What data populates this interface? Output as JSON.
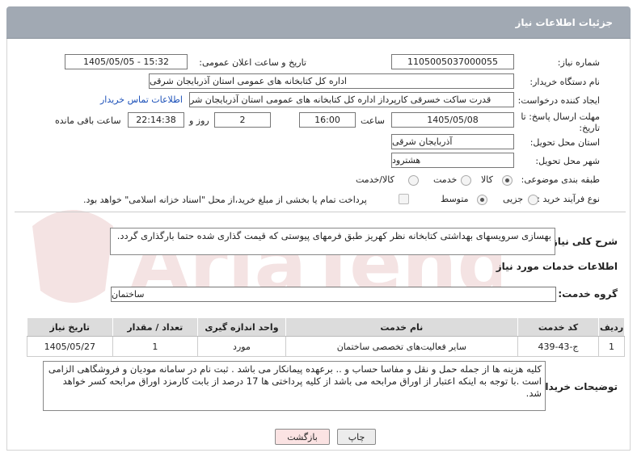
{
  "header": {
    "title": "جزئیات اطلاعات نیاز"
  },
  "fields": {
    "need_number_label": "شماره نیاز:",
    "need_number": "1105005037000055",
    "announce_label": "تاریخ و ساعت اعلان عمومی:",
    "announce_value": "1405/05/05 - 15:32",
    "buyer_org_label": "نام دستگاه خریدار:",
    "buyer_org": "اداره کل کتابخانه های عمومی استان آذربایجان شرقی",
    "creator_label": "ایجاد کننده درخواست:",
    "creator": "قدرت ساکت خسرقی کارپرداز اداره کل کتابخانه های عمومی استان آذربایجان شر",
    "contact_link": "اطلاعات تماس خریدار",
    "deadline_label_1": "مهلت ارسال پاسخ: تا",
    "deadline_label_2": "تاریخ:",
    "deadline_date": "1405/05/08",
    "time_label": "ساعت",
    "deadline_time": "16:00",
    "days_value": "2",
    "days_label": "روز و",
    "remaining_time": "22:14:38",
    "remaining_label": "ساعت باقی مانده",
    "province_label": "استان محل تحویل:",
    "province": "آذربایجان شرقی",
    "city_label": "شهر محل تحویل:",
    "city": "هشترود",
    "category_label": "طبقه بندی موضوعی:",
    "category_options": [
      "کالا",
      "خدمت",
      "کالا/خدمت"
    ],
    "purchase_type_label": "نوع فرآیند خرید :",
    "purchase_type_options": [
      "جزیی",
      "متوسط"
    ],
    "payment_note": "پرداخت تمام یا بخشی از مبلغ خرید،از محل \"اسناد خزانه اسلامی\" خواهد بود."
  },
  "summary": {
    "label": "شرح کلی نیاز:",
    "text": "بهسازی سرویسهای بهداشتی کتابخانه نظر کهریز طبق فرمهای پیوستی که قیمت گذاری شده حتما بارگذاری گردد."
  },
  "services": {
    "section_title": "اطلاعات خدمات مورد نیاز",
    "group_label": "گروه خدمت:",
    "group_value": "ساختمان",
    "columns": [
      "ردیف",
      "کد خدمت",
      "نام خدمت",
      "واحد اندازه گیری",
      "تعداد / مقدار",
      "تاریخ نیاز"
    ],
    "rows": [
      [
        "1",
        "ج-43-439",
        "سایر فعالیت‌های تخصصی ساختمان",
        "مورد",
        "1",
        "1405/05/27"
      ]
    ]
  },
  "buyer_notes": {
    "label": "توضیحات خریدار:",
    "text": "کلیه هزینه ها از جمله حمل و نقل و مفاسا حساب و .. برعهده پیمانکار می باشد . ثبت نام در سامانه مودیان و فروشگاهی الزامی است .با توجه به اینکه اعتبار از اوراق مرابحه می باشد از کلیه پرداختی ها 17 درصد از بابت کارمزد اوراق مرابحه کسر خواهد شد."
  },
  "buttons": {
    "print": "چاپ",
    "back": "بازگشت"
  },
  "colors": {
    "header_bg": "#a1a9b3",
    "link": "#1a4fb8",
    "back_btn_bg": "#fbe3e3",
    "print_btn_bg": "#ececec"
  }
}
